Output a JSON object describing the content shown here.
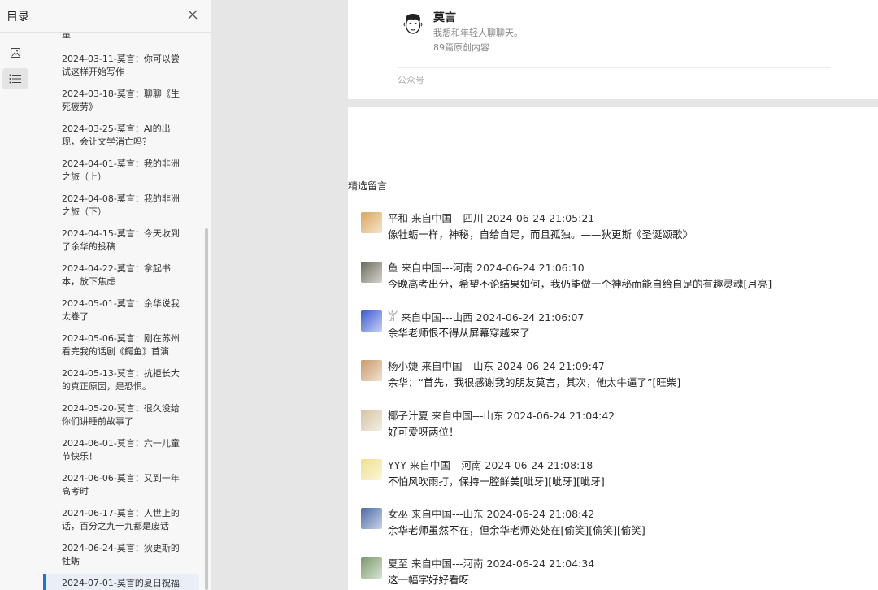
{
  "sidebar": {
    "title": "目录",
    "close_icon": "close-icon",
    "rail": [
      {
        "icon": "image-icon",
        "active": false
      },
      {
        "icon": "list-icon",
        "active": true
      }
    ],
    "toc": [
      {
        "l1": "量",
        "l2": ""
      },
      {
        "l1": "2024-03-11-莫言：你可以尝",
        "l2": "试这样开始写作"
      },
      {
        "l1": "2024-03-18-莫言：聊聊《生",
        "l2": "死疲劳》"
      },
      {
        "l1": "2024-03-25-莫言：AI的出",
        "l2": "现，会让文学消亡吗？"
      },
      {
        "l1": "2024-04-01-莫言：我的非洲",
        "l2": "之旅（上）"
      },
      {
        "l1": "2024-04-08-莫言：我的非洲",
        "l2": "之旅（下）"
      },
      {
        "l1": "2024-04-15-莫言：今天收到",
        "l2": "了余华的投稿"
      },
      {
        "l1": "2024-04-22-莫言：拿起书",
        "l2": "本，放下焦虑"
      },
      {
        "l1": "2024-05-01-莫言：余华说我",
        "l2": "太卷了"
      },
      {
        "l1": "2024-05-06-莫言：刚在苏州",
        "l2": "看完我的话剧《鳄鱼》首演"
      },
      {
        "l1": "2024-05-13-莫言：抗拒长大",
        "l2": "的真正原因，是恐惧。"
      },
      {
        "l1": "2024-05-20-莫言：很久没给",
        "l2": "你们讲睡前故事了"
      },
      {
        "l1": "2024-06-01-莫言：六一儿童",
        "l2": "节快乐！"
      },
      {
        "l1": "2024-06-06-莫言：又到一年",
        "l2": "高考时"
      },
      {
        "l1": "2024-06-17-莫言：人世上的",
        "l2": "话，百分之九十九都是废话"
      },
      {
        "l1": "2024-06-24-莫言：狄更斯的",
        "l2": "牡蛎"
      },
      {
        "l1": "2024-07-01-莫言的夏日祝福",
        "l2": ""
      }
    ]
  },
  "author": {
    "name": "莫言",
    "desc": "我想和年轻人聊聊天。",
    "count": "89篇原创内容",
    "account_label": "公众号"
  },
  "comments_title": "精选留言",
  "comments": [
    {
      "user": "平和",
      "meta": " 来自中国---四川 2024-06-24 21:05:21",
      "text": "像牡蛎一样，神秘，自给自足，而且孤独。——狄更斯《圣诞颂歌》",
      "color": "#d9a65a"
    },
    {
      "user": "鱼",
      "meta": " 来自中国---河南 2024-06-24 21:06:10",
      "text": "今晚高考出分，希望不论结果如何，我仍能做一个神秘而能自给自足的有趣灵魂[月亮]",
      "color": "#6b6b5a"
    },
    {
      "user": "𓀠",
      "meta": " 来自中国---山西 2024-06-24 21:06:07",
      "text": "余华老师恨不得从屏幕穿越来了",
      "color": "#3a5bd1"
    },
    {
      "user": "杨小婕",
      "meta": " 来自中国---山东 2024-06-24 21:09:47",
      "text": "余华：“首先，我很感谢我的朋友莫言，其次，他太牛逼了”[旺柴]",
      "color": "#c99a6a"
    },
    {
      "user": "椰子汁夏",
      "meta": " 来自中国---山东 2024-06-24 21:04:42",
      "text": "好可爱呀两位！",
      "color": "#d6c3a3"
    },
    {
      "user": "YYY",
      "meta": " 来自中国---河南 2024-06-24 21:08:18",
      "text": "不怕风吹雨打，保持一腔鲜美[呲牙][呲牙][呲牙]",
      "color": "#f0e08a"
    },
    {
      "user": "女巫",
      "meta": " 来自中国---山东 2024-06-24 21:08:42",
      "text": "余华老师虽然不在，但余华老师处处在[偷笑][偷笑][偷笑]",
      "color": "#4a6aa8"
    },
    {
      "user": "夏至",
      "meta": " 来自中国---河南 2024-06-24 21:04:34",
      "text": "这一幅字好好看呀",
      "color": "#7a9a6a"
    }
  ]
}
